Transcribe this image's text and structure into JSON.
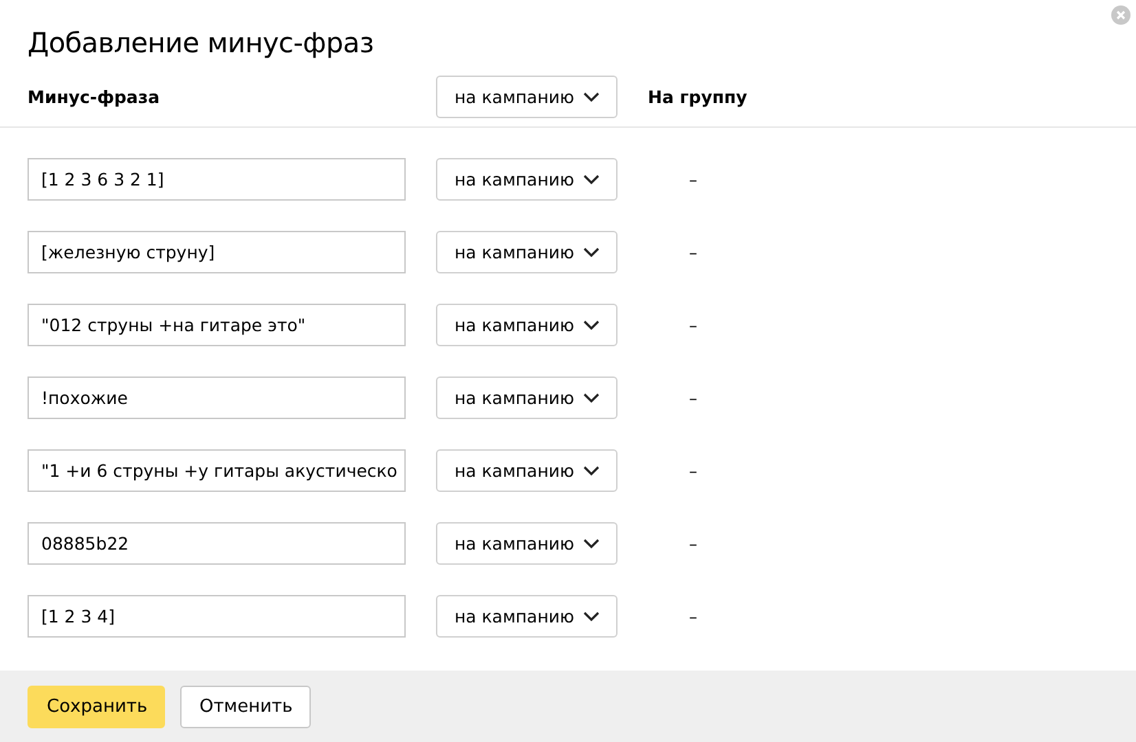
{
  "dialog": {
    "title": "Добавление минус-фраз"
  },
  "header": {
    "phrase_label": "Минус-фраза",
    "scope_select": "на кампанию",
    "group_label": "На группу"
  },
  "rows": [
    {
      "phrase": "[1 2 3 6 3 2 1]",
      "scope": "на кампанию",
      "group": "–"
    },
    {
      "phrase": "[железную струну]",
      "scope": "на кампанию",
      "group": "–"
    },
    {
      "phrase": "\"012 струны +на гитаре это\"",
      "scope": "на кампанию",
      "group": "–"
    },
    {
      "phrase": "!похожие",
      "scope": "на кампанию",
      "group": "–"
    },
    {
      "phrase": "\"1 +и 6 струны +у гитары акустическо",
      "scope": "на кампанию",
      "group": "–"
    },
    {
      "phrase": "08885b22",
      "scope": "на кампанию",
      "group": "–"
    },
    {
      "phrase": "[1 2 3 4]",
      "scope": "на кампанию",
      "group": "–"
    }
  ],
  "buttons": [
    {
      "label": "Сохранить",
      "kind": "primary"
    },
    {
      "label": "Отменить",
      "kind": "default"
    }
  ]
}
